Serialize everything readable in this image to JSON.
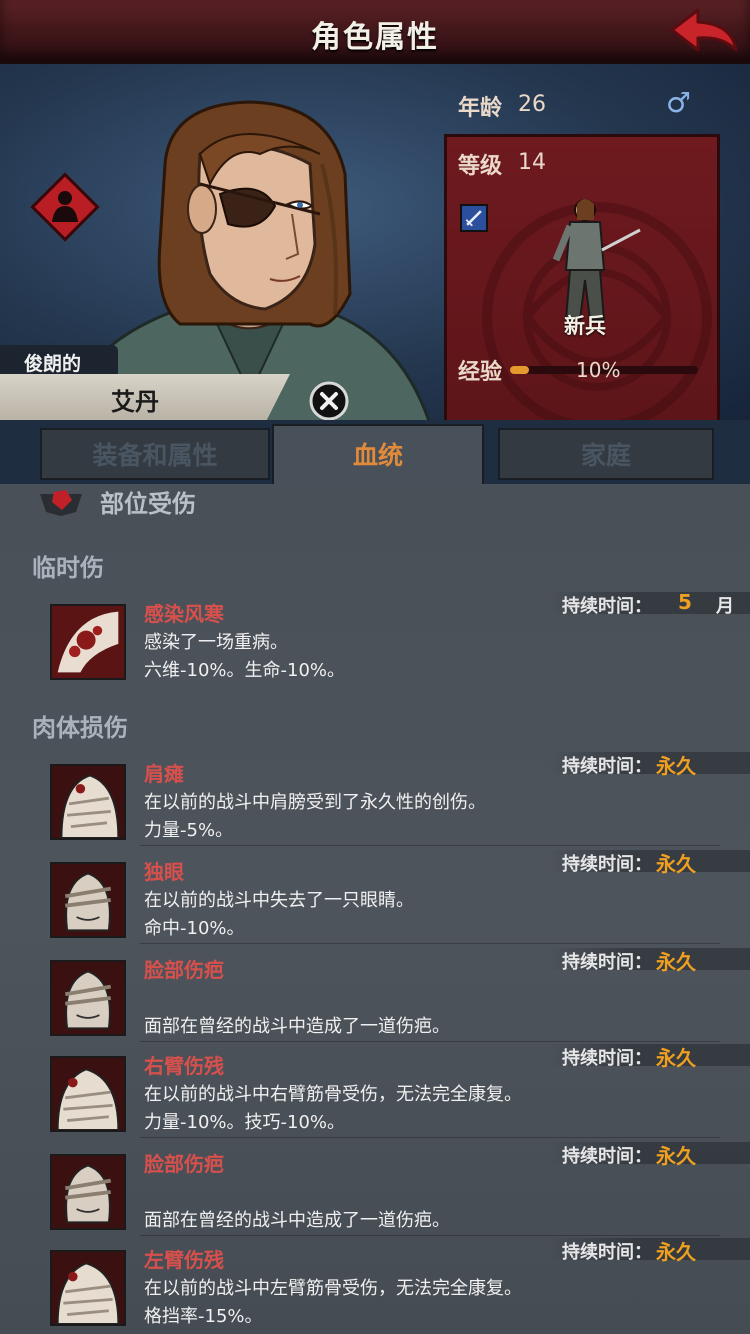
{
  "header": {
    "title": "角色属性",
    "back_icon": "back-arrow-icon"
  },
  "hero": {
    "nickname": "俊朗的",
    "name": "艾丹",
    "age_label": "年龄",
    "age": "26",
    "level_label": "等级",
    "level": "14",
    "gender_symbol": "♂",
    "class_name": "新兵",
    "xp_label": "经验",
    "xp_value": "10%",
    "xp_fraction": 0.1
  },
  "tabs": [
    {
      "label": "装备和属性",
      "active": false
    },
    {
      "label": "血统",
      "active": true
    },
    {
      "label": "家庭",
      "active": false
    }
  ],
  "injuries": {
    "section_title": "部位受伤",
    "temporary_title": "临时伤",
    "temporary": [
      {
        "name": "感染风寒",
        "lines": [
          "感染了一场重病。",
          "六维-10%。生命-10%。"
        ],
        "duration_label": "持续时间：",
        "duration_value": "5",
        "duration_unit": "月"
      }
    ],
    "permanent_title": "肉体损伤",
    "permanent": [
      {
        "name": "肩瘫",
        "lines": [
          "在以前的战斗中肩膀受到了永久性的创伤。",
          "力量-5%。"
        ],
        "duration_label": "持续时间：",
        "duration_value": "永久"
      },
      {
        "name": "独眼",
        "lines": [
          "在以前的战斗中失去了一只眼睛。",
          "命中-10%。"
        ],
        "duration_label": "持续时间：",
        "duration_value": "永久"
      },
      {
        "name": "脸部伤疤",
        "lines": [
          "",
          "面部在曾经的战斗中造成了一道伤疤。"
        ],
        "duration_label": "持续时间：",
        "duration_value": "永久"
      },
      {
        "name": "右臂伤残",
        "lines": [
          "在以前的战斗中右臂筋骨受伤，无法完全康复。",
          "力量-10%。技巧-10%。"
        ],
        "duration_label": "持续时间：",
        "duration_value": "永久"
      },
      {
        "name": "脸部伤疤",
        "lines": [
          "",
          "面部在曾经的战斗中造成了一道伤疤。"
        ],
        "duration_label": "持续时间：",
        "duration_value": "永久"
      },
      {
        "name": "左臂伤残",
        "lines": [
          "在以前的战斗中左臂筋骨受伤，无法完全康复。",
          "格挡率-15%。"
        ],
        "duration_label": "持续时间：",
        "duration_value": "永久"
      }
    ]
  }
}
